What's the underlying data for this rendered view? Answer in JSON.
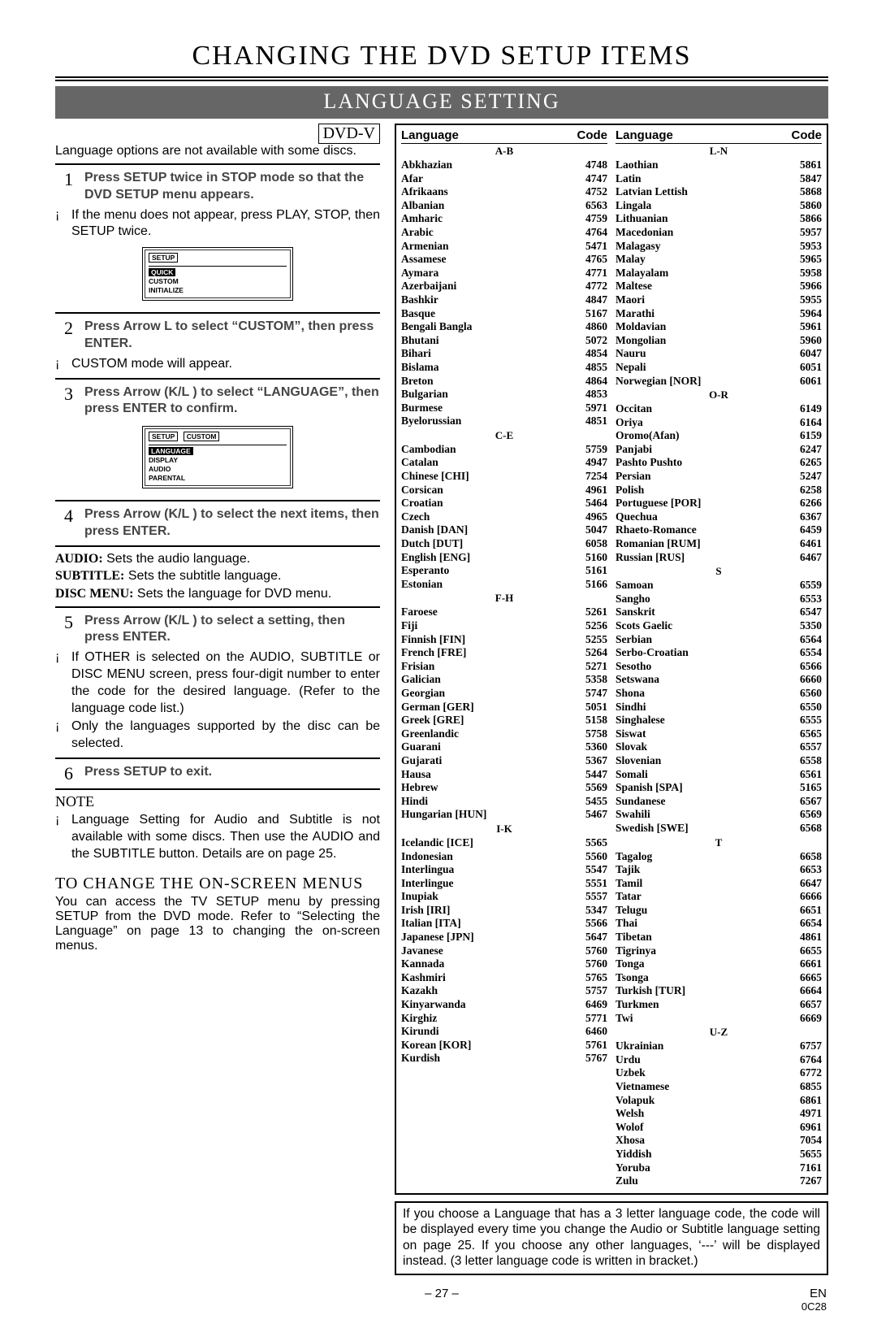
{
  "page_title": "CHANGING THE DVD SETUP ITEMS",
  "section_title": "LANGUAGE SETTING",
  "dvdv_badge": "DVD-V",
  "intro": "Language options are not available with some discs.",
  "steps": {
    "s1": "Press SETUP twice in STOP mode so that the DVD SETUP menu appears.",
    "s1_note": "If the menu does not appear, press PLAY, STOP, then SETUP twice.",
    "s2": "Press Arrow L  to select “CUSTOM”, then press ENTER.",
    "s2_note": "CUSTOM mode will appear.",
    "s3": "Press Arrow (K/L ) to select “LANGUAGE”, then press ENTER to confirm.",
    "s4": "Press Arrow (K/L ) to select the next items, then press ENTER.",
    "s5": "Press Arrow (K/L ) to select a setting, then press ENTER.",
    "s5_note1": "If OTHER is selected on the AUDIO, SUBTITLE or DISC MENU screen, press four-digit number to enter the code for the desired language. (Refer to the language code list.)",
    "s5_note2": "Only the languages supported by the disc can be selected.",
    "s6": "Press SETUP to exit."
  },
  "definitions": {
    "audio": {
      "label": "AUDIO:",
      "text": "Sets the audio language."
    },
    "subtitle": {
      "label": "SUBTITLE:",
      "text": "Sets the subtitle language."
    },
    "discmenu": {
      "label": "DISC MENU:",
      "text": "Sets the language for DVD menu."
    }
  },
  "note_heading": "NOTE",
  "note_text": "Language Setting for Audio and Subtitle is not available with some discs. Then use the AUDIO and the SUBTITLE button. Details are on page 25.",
  "subheading": "TO CHANGE THE ON-SCREEN MENUS",
  "sub_text": "You can access the TV SETUP menu by pressing SETUP from the DVD mode. Refer to “Selecting the Language” on page 13 to changing the on-screen menus.",
  "screen1": {
    "title": "SETUP",
    "items": [
      "QUICK",
      "CUSTOM",
      "INITIALIZE"
    ]
  },
  "screen2": {
    "title": "SETUP",
    "tab": "CUSTOM",
    "items": [
      "LANGUAGE",
      "DISPLAY",
      "AUDIO",
      "PARENTAL"
    ]
  },
  "table_headers": {
    "lang": "Language",
    "code": "Code"
  },
  "right_note": "If you choose a Language that has a 3 letter language code, the code will be displayed every time you change the Audio or Subtitle language setting on page 25. If you choose any other languages, ‘---’ will be displayed instead. (3 letter language code is written in bracket.)",
  "page_number": "– 27 –",
  "page_lang": "EN",
  "page_code": "0C28",
  "lang_columns": [
    [
      {
        "group": "A-B"
      },
      {
        "name": "Abkhazian",
        "code": "4748"
      },
      {
        "name": "Afar",
        "code": "4747"
      },
      {
        "name": "Afrikaans",
        "code": "4752"
      },
      {
        "name": "Albanian",
        "code": "6563"
      },
      {
        "name": "Amharic",
        "code": "4759"
      },
      {
        "name": "Arabic",
        "code": "4764"
      },
      {
        "name": "Armenian",
        "code": "5471"
      },
      {
        "name": "Assamese",
        "code": "4765"
      },
      {
        "name": "Aymara",
        "code": "4771"
      },
      {
        "name": "Azerbaijani",
        "code": "4772"
      },
      {
        "name": "Bashkir",
        "code": "4847"
      },
      {
        "name": "Basque",
        "code": "5167"
      },
      {
        "name": "Bengali Bangla",
        "code": "4860"
      },
      {
        "name": "Bhutani",
        "code": "5072"
      },
      {
        "name": "Bihari",
        "code": "4854"
      },
      {
        "name": "Bislama",
        "code": "4855"
      },
      {
        "name": "Breton",
        "code": "4864"
      },
      {
        "name": "Bulgarian",
        "code": "4853"
      },
      {
        "name": "Burmese",
        "code": "5971"
      },
      {
        "name": "Byelorussian",
        "code": "4851"
      },
      {
        "group": "C-E"
      },
      {
        "name": "Cambodian",
        "code": "5759"
      },
      {
        "name": "Catalan",
        "code": "4947"
      },
      {
        "name": "Chinese [CHI]",
        "code": "7254"
      },
      {
        "name": "Corsican",
        "code": "4961"
      },
      {
        "name": "Croatian",
        "code": "5464"
      },
      {
        "name": "Czech",
        "code": "4965"
      },
      {
        "name": "Danish [DAN]",
        "code": "5047"
      },
      {
        "name": "Dutch [DUT]",
        "code": "6058"
      },
      {
        "name": "English [ENG]",
        "code": "5160"
      },
      {
        "name": "Esperanto",
        "code": "5161"
      },
      {
        "name": "Estonian",
        "code": "5166"
      },
      {
        "group": "F-H"
      },
      {
        "name": "Faroese",
        "code": "5261"
      },
      {
        "name": "Fiji",
        "code": "5256"
      },
      {
        "name": "Finnish [FIN]",
        "code": "5255"
      },
      {
        "name": "French [FRE]",
        "code": "5264"
      },
      {
        "name": "Frisian",
        "code": "5271"
      },
      {
        "name": "Galician",
        "code": "5358"
      },
      {
        "name": "Georgian",
        "code": "5747"
      },
      {
        "name": "German [GER]",
        "code": "5051"
      },
      {
        "name": "Greek [GRE]",
        "code": "5158"
      },
      {
        "name": "Greenlandic",
        "code": "5758"
      },
      {
        "name": "Guarani",
        "code": "5360"
      },
      {
        "name": "Gujarati",
        "code": "5367"
      },
      {
        "name": "Hausa",
        "code": "5447"
      },
      {
        "name": "Hebrew",
        "code": "5569"
      },
      {
        "name": "Hindi",
        "code": "5455"
      },
      {
        "name": "Hungarian [HUN]",
        "code": "5467"
      },
      {
        "group": "I-K"
      },
      {
        "name": "Icelandic [ICE]",
        "code": "5565"
      },
      {
        "name": "Indonesian",
        "code": "5560"
      },
      {
        "name": "Interlingua",
        "code": "5547"
      },
      {
        "name": "Interlingue",
        "code": "5551"
      },
      {
        "name": "Inupiak",
        "code": "5557"
      },
      {
        "name": "Irish [IRI]",
        "code": "5347"
      },
      {
        "name": "Italian [ITA]",
        "code": "5566"
      },
      {
        "name": "Japanese [JPN]",
        "code": "5647"
      },
      {
        "name": "Javanese",
        "code": "5760"
      },
      {
        "name": "Kannada",
        "code": "5760"
      },
      {
        "name": "Kashmiri",
        "code": "5765"
      },
      {
        "name": "Kazakh",
        "code": "5757"
      },
      {
        "name": "Kinyarwanda",
        "code": "6469"
      },
      {
        "name": "Kirghiz",
        "code": "5771"
      },
      {
        "name": "Kirundi",
        "code": "6460"
      },
      {
        "name": "Korean [KOR]",
        "code": "5761"
      },
      {
        "name": "Kurdish",
        "code": "5767"
      }
    ],
    [
      {
        "group": "L-N"
      },
      {
        "name": "Laothian",
        "code": "5861"
      },
      {
        "name": "Latin",
        "code": "5847"
      },
      {
        "name": "Latvian Lettish",
        "code": "5868"
      },
      {
        "name": "Lingala",
        "code": "5860"
      },
      {
        "name": "Lithuanian",
        "code": "5866"
      },
      {
        "name": "Macedonian",
        "code": "5957"
      },
      {
        "name": "Malagasy",
        "code": "5953"
      },
      {
        "name": "Malay",
        "code": "5965"
      },
      {
        "name": "Malayalam",
        "code": "5958"
      },
      {
        "name": "Maltese",
        "code": "5966"
      },
      {
        "name": "Maori",
        "code": "5955"
      },
      {
        "name": "Marathi",
        "code": "5964"
      },
      {
        "name": "Moldavian",
        "code": "5961"
      },
      {
        "name": "Mongolian",
        "code": "5960"
      },
      {
        "name": "Nauru",
        "code": "6047"
      },
      {
        "name": "Nepali",
        "code": "6051"
      },
      {
        "name": "Norwegian [NOR]",
        "code": "6061"
      },
      {
        "group": "O-R"
      },
      {
        "name": "Occitan",
        "code": "6149"
      },
      {
        "name": "Oriya",
        "code": "6164"
      },
      {
        "name": "Oromo(Afan)",
        "code": "6159"
      },
      {
        "name": "Panjabi",
        "code": "6247"
      },
      {
        "name": "Pashto Pushto",
        "code": "6265"
      },
      {
        "name": "Persian",
        "code": "5247"
      },
      {
        "name": "Polish",
        "code": "6258"
      },
      {
        "name": "Portuguese [POR]",
        "code": "6266"
      },
      {
        "name": "Quechua",
        "code": "6367"
      },
      {
        "name": "Rhaeto-Romance",
        "code": "6459"
      },
      {
        "name": "Romanian [RUM]",
        "code": "6461"
      },
      {
        "name": "Russian [RUS]",
        "code": "6467"
      },
      {
        "group": "S"
      },
      {
        "name": "Samoan",
        "code": "6559"
      },
      {
        "name": "Sangho",
        "code": "6553"
      },
      {
        "name": "Sanskrit",
        "code": "6547"
      },
      {
        "name": "Scots Gaelic",
        "code": "5350"
      },
      {
        "name": "Serbian",
        "code": "6564"
      },
      {
        "name": "Serbo-Croatian",
        "code": "6554"
      },
      {
        "name": "Sesotho",
        "code": "6566"
      },
      {
        "name": "Setswana",
        "code": "6660"
      },
      {
        "name": "Shona",
        "code": "6560"
      },
      {
        "name": "Sindhi",
        "code": "6550"
      },
      {
        "name": "Singhalese",
        "code": "6555"
      },
      {
        "name": "Siswat",
        "code": "6565"
      },
      {
        "name": "Slovak",
        "code": "6557"
      },
      {
        "name": "Slovenian",
        "code": "6558"
      },
      {
        "name": "Somali",
        "code": "6561"
      },
      {
        "name": "Spanish [SPA]",
        "code": "5165"
      },
      {
        "name": "Sundanese",
        "code": "6567"
      },
      {
        "name": "Swahili",
        "code": "6569"
      },
      {
        "name": "Swedish [SWE]",
        "code": "6568"
      },
      {
        "group": "T"
      },
      {
        "name": "Tagalog",
        "code": "6658"
      },
      {
        "name": "Tajik",
        "code": "6653"
      },
      {
        "name": "Tamil",
        "code": "6647"
      },
      {
        "name": "Tatar",
        "code": "6666"
      },
      {
        "name": "Telugu",
        "code": "6651"
      },
      {
        "name": "Thai",
        "code": "6654"
      },
      {
        "name": "Tibetan",
        "code": "4861"
      },
      {
        "name": "Tigrinya",
        "code": "6655"
      },
      {
        "name": "Tonga",
        "code": "6661"
      },
      {
        "name": "Tsonga",
        "code": "6665"
      },
      {
        "name": "Turkish [TUR]",
        "code": "6664"
      },
      {
        "name": "Turkmen",
        "code": "6657"
      },
      {
        "name": "Twi",
        "code": "6669"
      },
      {
        "group": "U-Z"
      },
      {
        "name": "Ukrainian",
        "code": "6757"
      },
      {
        "name": "Urdu",
        "code": "6764"
      },
      {
        "name": "Uzbek",
        "code": "6772"
      },
      {
        "name": "Vietnamese",
        "code": "6855"
      },
      {
        "name": "Volapuk",
        "code": "6861"
      },
      {
        "name": "Welsh",
        "code": "4971"
      },
      {
        "name": "Wolof",
        "code": "6961"
      },
      {
        "name": "Xhosa",
        "code": "7054"
      },
      {
        "name": "Yiddish",
        "code": "5655"
      },
      {
        "name": "Yoruba",
        "code": "7161"
      },
      {
        "name": "Zulu",
        "code": "7267"
      }
    ]
  ]
}
